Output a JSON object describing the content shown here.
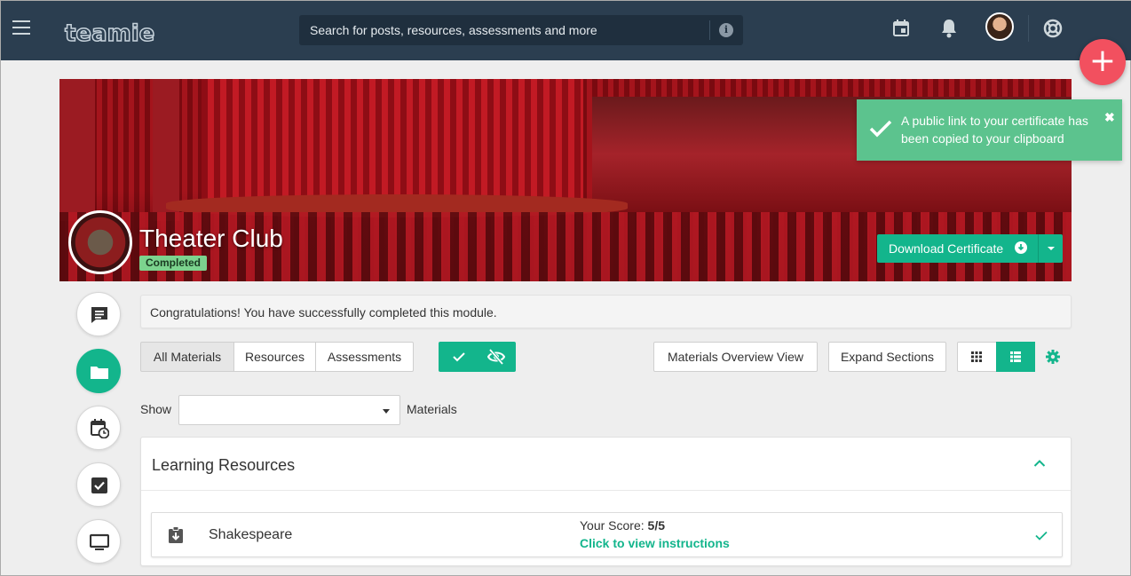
{
  "header": {
    "logo_text": "teamie",
    "search_placeholder": "Search for posts, resources, assessments and more"
  },
  "toast": {
    "message": "A public link to your certificate has been copied to your clipboard",
    "close": "✖"
  },
  "banner": {
    "title": "Theater Club",
    "status_badge": "Completed",
    "download_label": "Download Certificate"
  },
  "congrats_message": "Congratulations! You have successfully completed this module.",
  "filter_tabs": [
    "All Materials",
    "Resources",
    "Assessments"
  ],
  "active_filter": "All Materials",
  "toolbar": {
    "overview_label": "Materials Overview View",
    "expand_label": "Expand Sections"
  },
  "show_filter": {
    "show_label": "Show",
    "selected": "",
    "materials_label": "Materials"
  },
  "section": {
    "title": "Learning Resources",
    "items": [
      {
        "title": "Shakespeare",
        "score_label": "Your Score:",
        "score_value": "5/5",
        "instructions_link": "Click to view instructions"
      }
    ]
  },
  "colors": {
    "accent": "#13b58c",
    "topbar": "#2b3e50",
    "fab": "#f2505f",
    "toast": "#5cc38e"
  },
  "icons": {
    "topbar": [
      "menu-icon",
      "calendar-icon",
      "bell-icon",
      "avatar",
      "help-lifebuoy-icon"
    ],
    "sidebar": [
      "chat-icon",
      "folder-icon",
      "calendar-clock-icon",
      "checkbox-icon",
      "monitor-icon"
    ]
  }
}
